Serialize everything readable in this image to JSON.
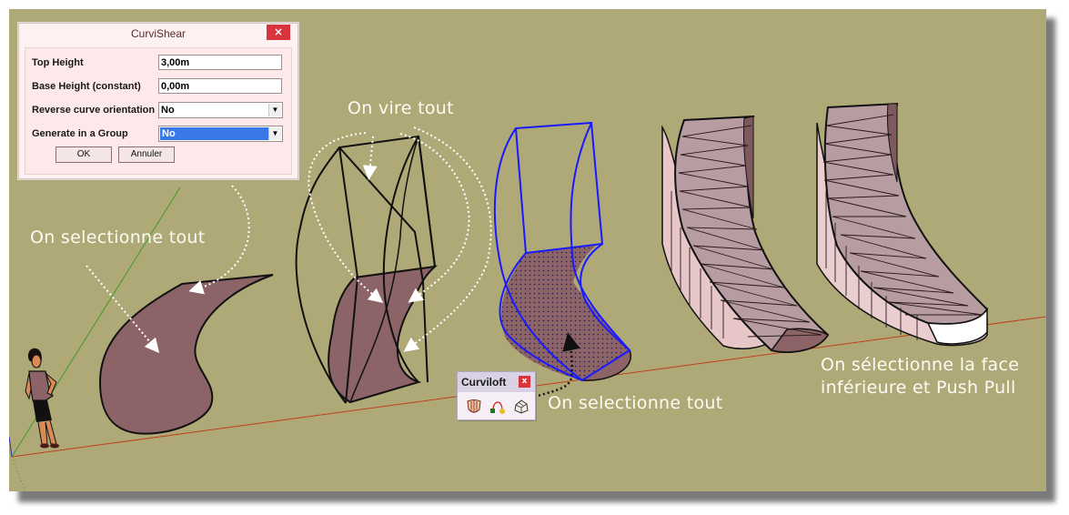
{
  "dialog": {
    "title": "CurviShear",
    "close_label": "×",
    "fields": [
      {
        "label": "Top Height",
        "value": "3,00m"
      },
      {
        "label": "Base Height (constant)",
        "value": "0,00m"
      }
    ],
    "selects": [
      {
        "label": "Reverse curve orientation",
        "value": "No"
      },
      {
        "label": "Generate in a Group",
        "value": "No"
      }
    ],
    "ok_label": "OK",
    "cancel_label": "Annuler"
  },
  "toolbar": {
    "title": "Curviloft",
    "close_label": "x",
    "icons": [
      "loft-by-spline-icon",
      "join-by-curve-icon",
      "skinning-icon"
    ]
  },
  "annotations": {
    "select_all_1": "On selectionne tout",
    "rotate_all": "On vire tout",
    "select_all_2": "On selectionne tout",
    "push_pull_line1": "On sélectionne la face",
    "push_pull_line2": "inférieure et Push Pull"
  },
  "colors": {
    "background": "#afa977",
    "face": "#8c6468",
    "selection": "#1a1aff",
    "text": "#fdfbf3"
  }
}
